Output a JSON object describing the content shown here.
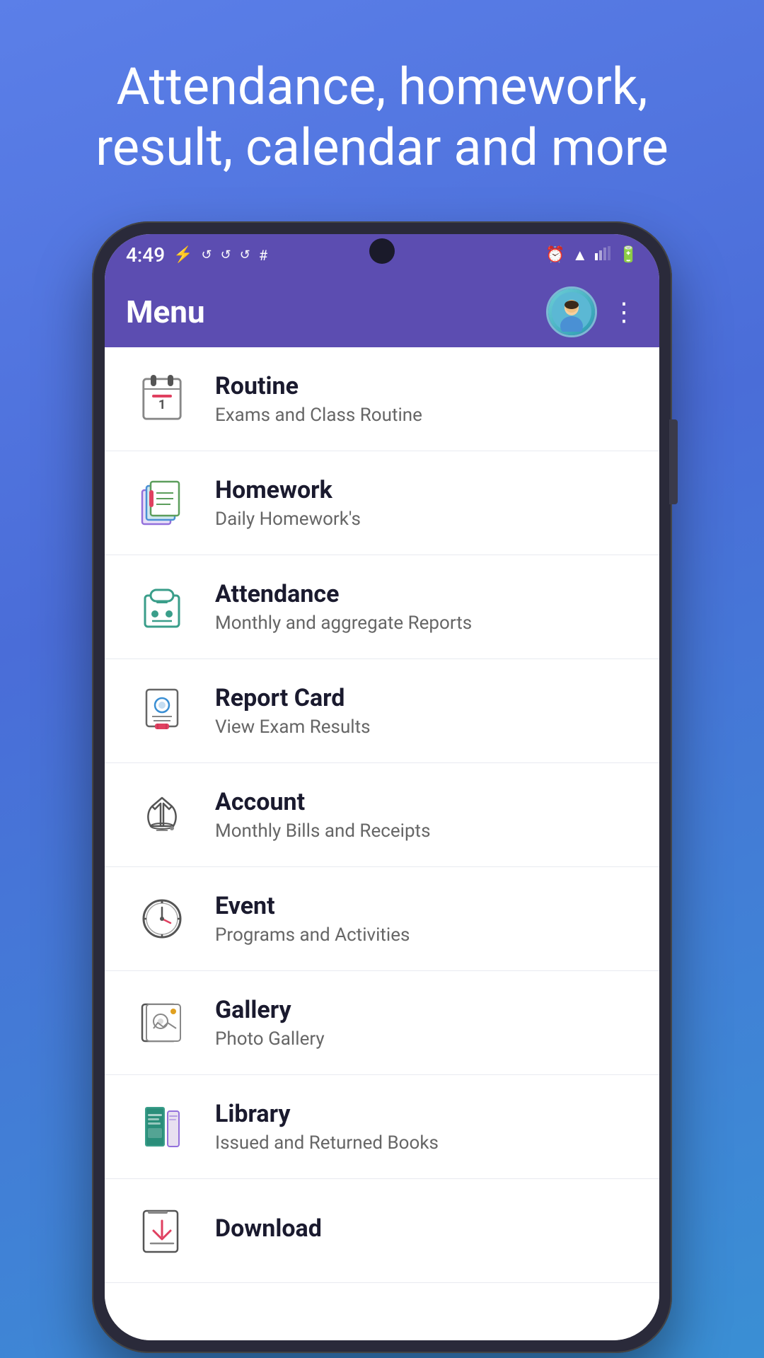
{
  "background": {
    "headline": "Attendance, homework, result, calendar and more"
  },
  "status_bar": {
    "time": "4:49",
    "icons": [
      "battery-charging",
      "sync",
      "sync",
      "sync",
      "slack",
      "alarm",
      "wifi",
      "signal",
      "battery"
    ]
  },
  "app_bar": {
    "title": "Menu",
    "more_label": "⋮"
  },
  "menu_items": [
    {
      "id": "routine",
      "title": "Routine",
      "subtitle": "Exams and Class Routine",
      "icon": "routine"
    },
    {
      "id": "homework",
      "title": "Homework",
      "subtitle": "Daily Homework's",
      "icon": "homework"
    },
    {
      "id": "attendance",
      "title": "Attendance",
      "subtitle": "Monthly and aggregate Reports",
      "icon": "attendance"
    },
    {
      "id": "report-card",
      "title": "Report Card",
      "subtitle": "View Exam Results",
      "icon": "report-card"
    },
    {
      "id": "account",
      "title": "Account",
      "subtitle": "Monthly Bills and Receipts",
      "icon": "account"
    },
    {
      "id": "event",
      "title": "Event",
      "subtitle": "Programs and Activities",
      "icon": "event"
    },
    {
      "id": "gallery",
      "title": "Gallery",
      "subtitle": "Photo Gallery",
      "icon": "gallery"
    },
    {
      "id": "library",
      "title": "Library",
      "subtitle": "Issued and Returned Books",
      "icon": "library"
    },
    {
      "id": "download",
      "title": "Download",
      "subtitle": "",
      "icon": "download"
    }
  ]
}
